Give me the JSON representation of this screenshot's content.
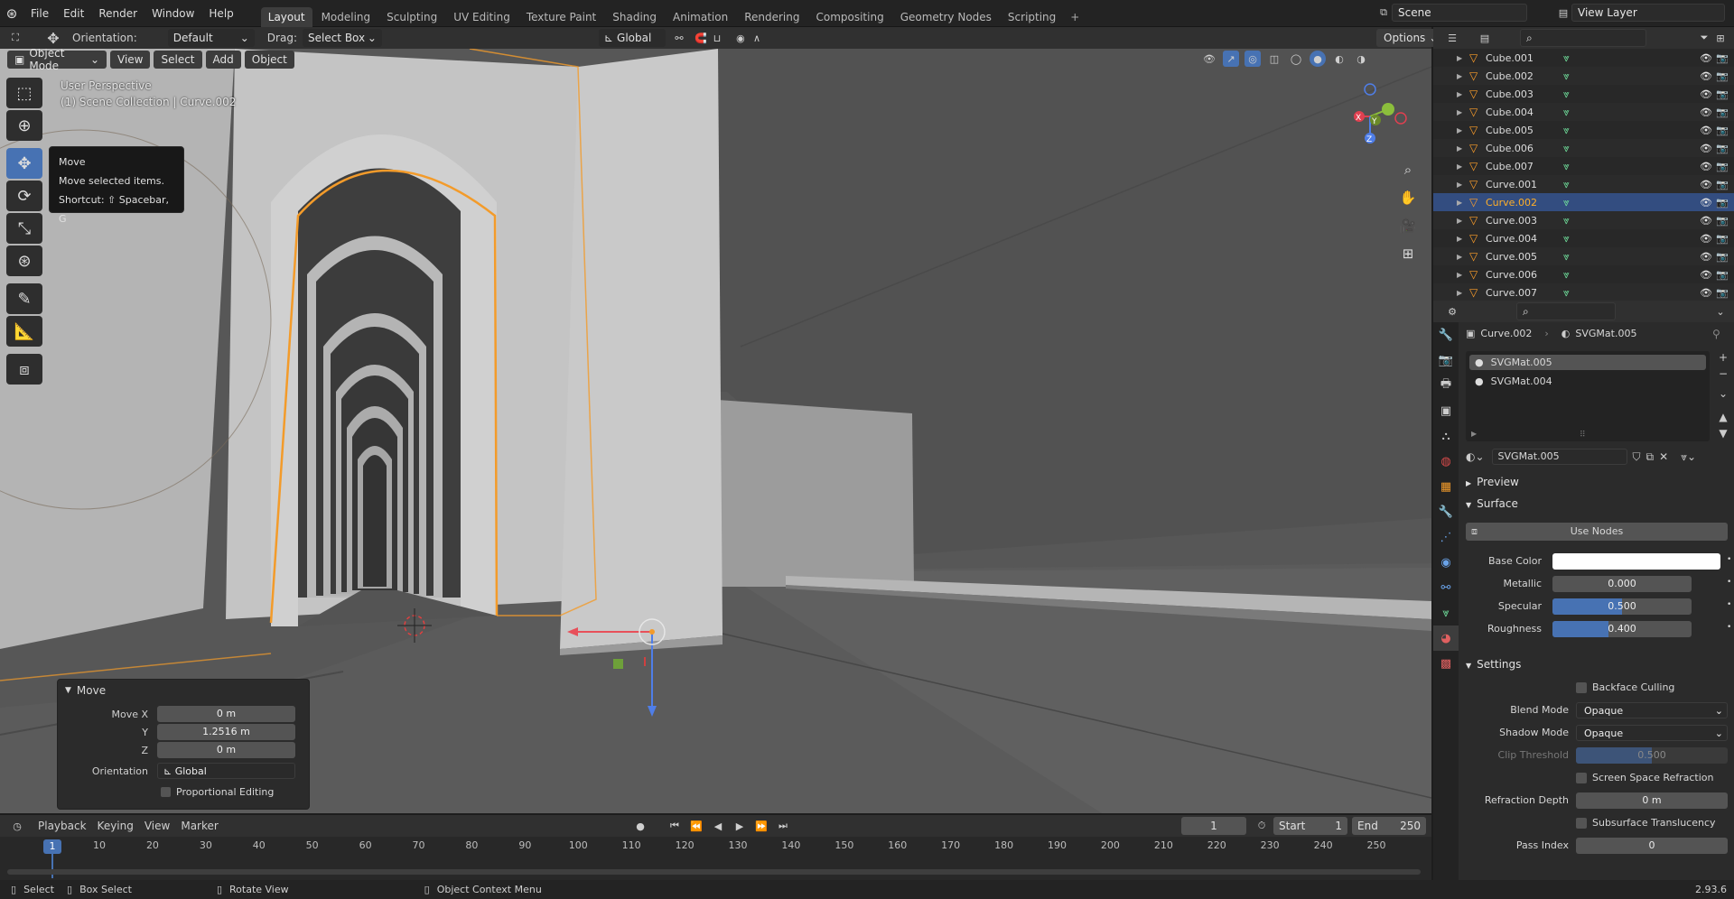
{
  "topbar": {
    "menus": [
      "File",
      "Edit",
      "Render",
      "Window",
      "Help"
    ],
    "workspaces": [
      "Layout",
      "Modeling",
      "Sculpting",
      "UV Editing",
      "Texture Paint",
      "Shading",
      "Animation",
      "Rendering",
      "Compositing",
      "Geometry Nodes",
      "Scripting"
    ],
    "active_workspace": "Layout",
    "scene": "Scene",
    "view_layer": "View Layer"
  },
  "viewport_header": {
    "orientation_label": "Orientation:",
    "orientation_value": "Default",
    "drag_label": "Drag:",
    "drag_value": "Select Box",
    "transform_orientation": "Global",
    "options_label": "Options",
    "mode": "Object Mode",
    "menus": [
      "View",
      "Select",
      "Add",
      "Object"
    ]
  },
  "viewport": {
    "perspective": "User Perspective",
    "collection_info": "(1) Scene Collection | Curve.002",
    "tooltip": {
      "title": "Move",
      "desc": "Move selected items.",
      "shortcut": "Shortcut: ⇧ Spacebar, G"
    },
    "operator": {
      "title": "Move",
      "move_x_label": "Move X",
      "move_x": "0 m",
      "y_label": "Y",
      "y": "1.2516 m",
      "z_label": "Z",
      "z": "0 m",
      "orientation_label": "Orientation",
      "orientation": "Global",
      "proportional": "Proportional Editing"
    },
    "axis_labels": {
      "x": "X",
      "y": "Y",
      "z": "Z"
    }
  },
  "outliner": {
    "items": [
      {
        "name": "Cube.001",
        "selected": false
      },
      {
        "name": "Cube.002",
        "selected": false
      },
      {
        "name": "Cube.003",
        "selected": false
      },
      {
        "name": "Cube.004",
        "selected": false
      },
      {
        "name": "Cube.005",
        "selected": false
      },
      {
        "name": "Cube.006",
        "selected": false
      },
      {
        "name": "Cube.007",
        "selected": false
      },
      {
        "name": "Curve.001",
        "selected": false
      },
      {
        "name": "Curve.002",
        "selected": true
      },
      {
        "name": "Curve.003",
        "selected": false
      },
      {
        "name": "Curve.004",
        "selected": false
      },
      {
        "name": "Curve.005",
        "selected": false
      },
      {
        "name": "Curve.006",
        "selected": false
      },
      {
        "name": "Curve.007",
        "selected": false
      }
    ]
  },
  "properties": {
    "object_name": "Curve.002",
    "material_name": "SVGMat.005",
    "slots": [
      "SVGMat.005",
      "SVGMat.004"
    ],
    "material_field": "SVGMat.005",
    "preview_label": "Preview",
    "surface_label": "Surface",
    "use_nodes": "Use Nodes",
    "base_color_label": "Base Color",
    "metallic_label": "Metallic",
    "metallic": "0.000",
    "specular_label": "Specular",
    "specular": "0.500",
    "specular_fill": 0.5,
    "roughness_label": "Roughness",
    "roughness": "0.400",
    "roughness_fill": 0.4,
    "settings_label": "Settings",
    "backface_culling": "Backface Culling",
    "blend_mode_label": "Blend Mode",
    "blend_mode": "Opaque",
    "shadow_mode_label": "Shadow Mode",
    "shadow_mode": "Opaque",
    "clip_threshold_label": "Clip Threshold",
    "clip_threshold": "0.500",
    "clip_fill": 0.5,
    "screen_space_refraction": "Screen Space Refraction",
    "refraction_depth_label": "Refraction Depth",
    "refraction_depth": "0 m",
    "subsurface_translucency": "Subsurface Translucency",
    "pass_index_label": "Pass Index",
    "pass_index": "0"
  },
  "timeline": {
    "menus": [
      "Playback",
      "Keying",
      "View",
      "Marker"
    ],
    "current_frame": "1",
    "start_label": "Start",
    "start": "1",
    "end_label": "End",
    "end": "250",
    "ticks": [
      "1",
      "10",
      "20",
      "30",
      "40",
      "50",
      "60",
      "70",
      "80",
      "90",
      "100",
      "110",
      "120",
      "130",
      "140",
      "150",
      "160",
      "170",
      "180",
      "190",
      "200",
      "210",
      "220",
      "230",
      "240",
      "250"
    ]
  },
  "statusbar": {
    "select": "Select",
    "box_select": "Box Select",
    "rotate_view": "Rotate View",
    "context_menu": "Object Context Menu",
    "version": "2.93.6"
  },
  "colors": {
    "accent": "#4772b3",
    "selection_orange": "#ffaf29",
    "header": "#303030",
    "viewport_bg": "#595959"
  }
}
